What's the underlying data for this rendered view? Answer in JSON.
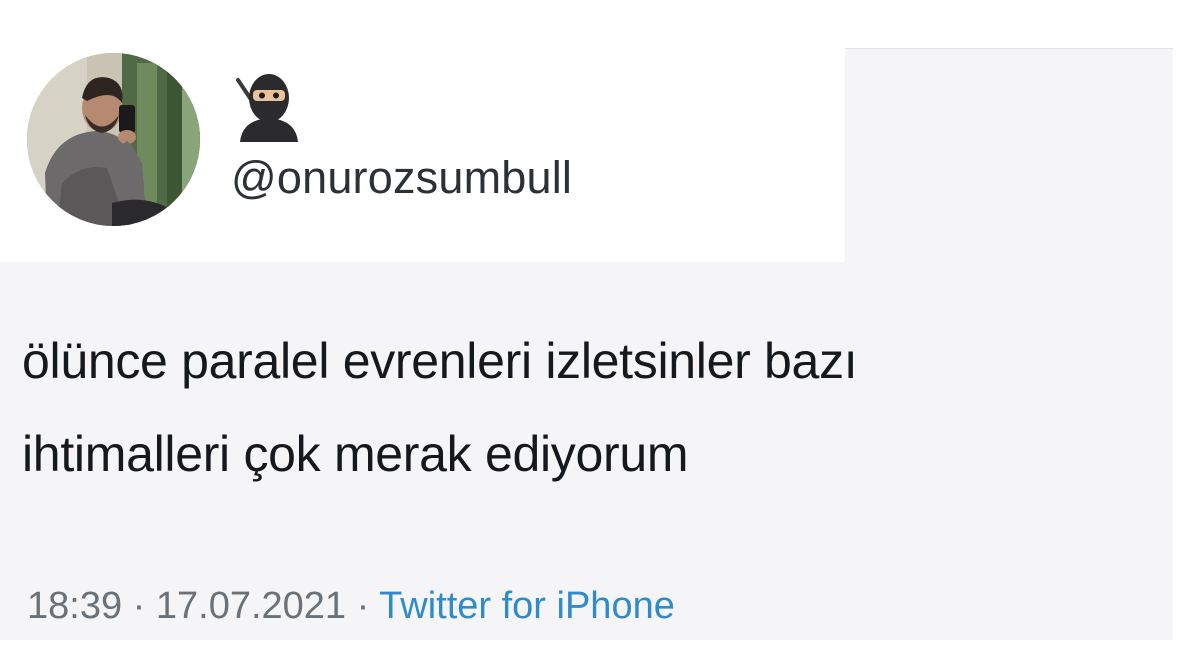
{
  "tweet": {
    "author_emoji": "ninja-emoji",
    "handle": "@onurozsumbull",
    "text_line_1": "ölünce paralel evrenleri izletsinler bazı",
    "text_line_2": "ihtimalleri çok merak ediyorum",
    "time": "18:39",
    "separator_1": " · ",
    "date": "17.07.2021",
    "separator_2": " · ",
    "source": "Twitter for iPhone"
  },
  "colors": {
    "text": "#15181c",
    "meta": "#6a7178",
    "link": "#2f8bc9"
  }
}
